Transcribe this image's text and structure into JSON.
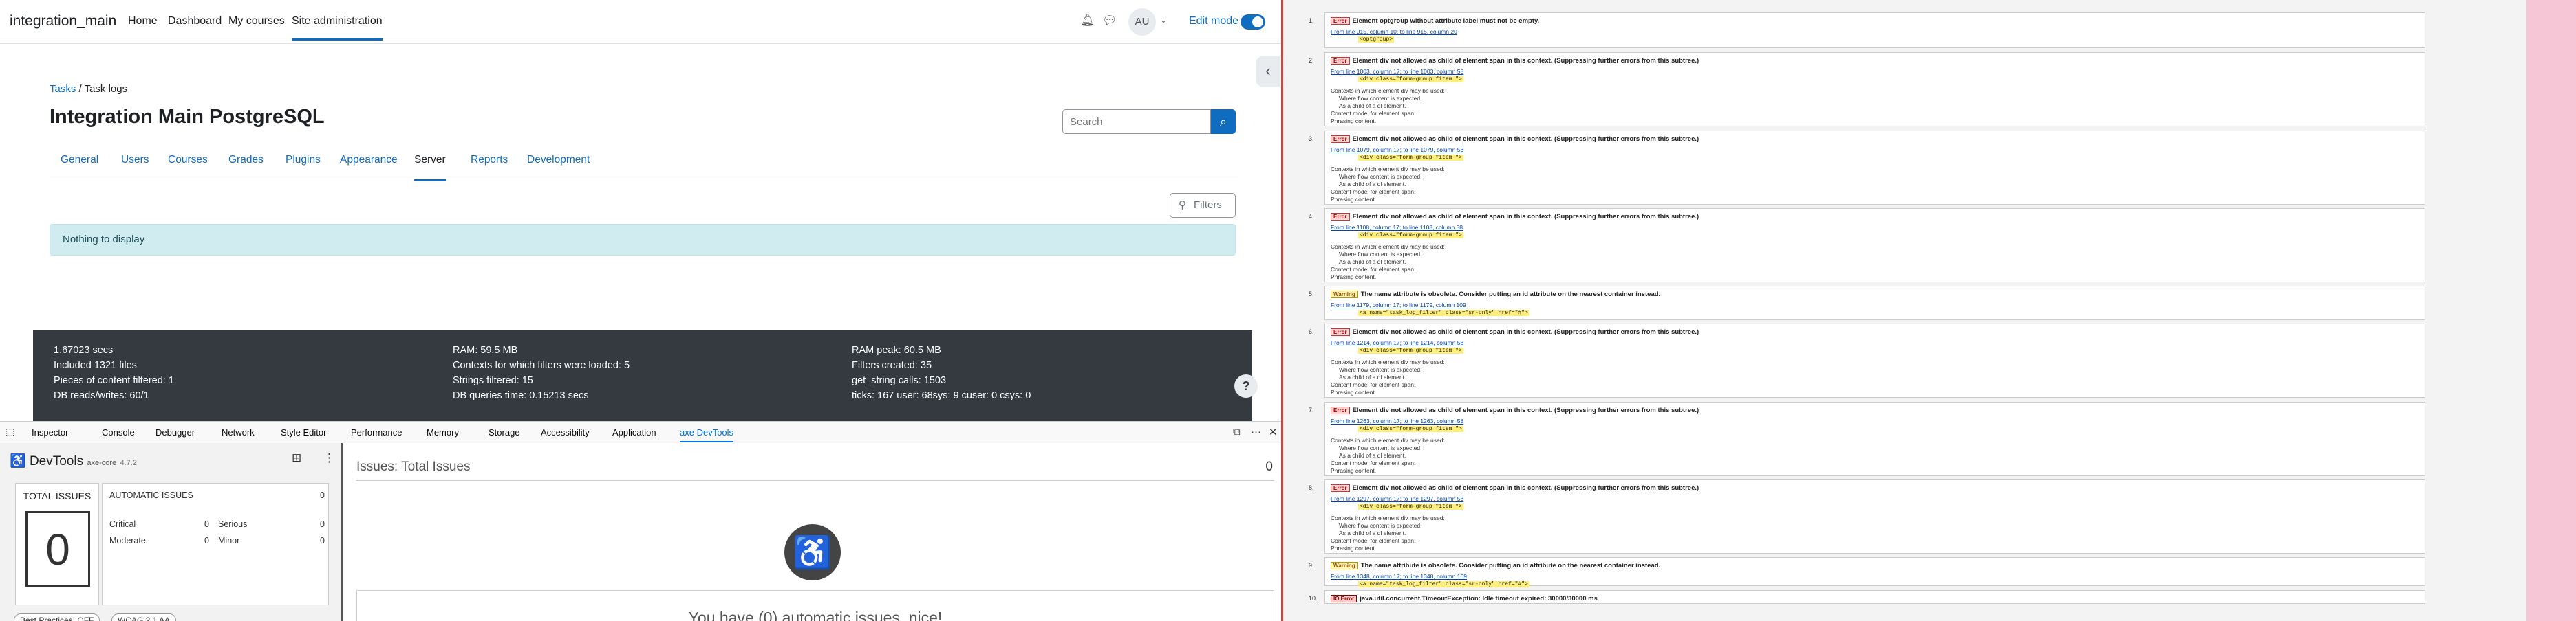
{
  "moodle": {
    "brand": "integration_main",
    "nav": [
      "Home",
      "Dashboard",
      "My courses",
      "Site administration"
    ],
    "nav_active": "Site administration",
    "avatar_initials": "AU",
    "edit_mode_label": "Edit mode",
    "breadcrumb": [
      "Tasks",
      "Task logs"
    ],
    "page_title": "Integration Main PostgreSQL",
    "search_placeholder": "Search",
    "tabs": [
      "General",
      "Users",
      "Courses",
      "Grades",
      "Plugins",
      "Appearance",
      "Server",
      "Reports",
      "Development"
    ],
    "active_tab": "Server",
    "filters_label": "Filters",
    "alert": "Nothing to display",
    "footer": {
      "col1": [
        "1.67023 secs",
        "",
        "Included 1321 files",
        "Pieces of content filtered: 1",
        "DB reads/writes: 60/1"
      ],
      "col2": [
        "RAM: 59.5 MB",
        "",
        "Contexts for which filters were loaded: 5",
        "Strings filtered: 15",
        "DB queries time: 0.15213 secs"
      ],
      "col3": [
        "RAM peak: 60.5 MB",
        "",
        "Filters created: 35",
        "get_string calls: 1503",
        "ticks: 167 user: 68sys: 9 cuser: 0 csys: 0"
      ]
    },
    "help": "?"
  },
  "devtools": {
    "tabs": [
      "Inspector",
      "Console",
      "Debugger",
      "Network",
      "Style Editor",
      "Performance",
      "Memory",
      "Storage",
      "Accessibility",
      "Application",
      "axe DevTools"
    ],
    "active_tab": "axe DevTools",
    "axe": {
      "title": "DevTools",
      "subtitle": "axe-core",
      "version": "4.7.2",
      "total_label": "TOTAL ISSUES",
      "total": "0",
      "auto_label": "AUTOMATIC ISSUES",
      "auto_count": "0",
      "critical_label": "Critical",
      "critical": "0",
      "serious_label": "Serious",
      "serious": "0",
      "moderate_label": "Moderate",
      "moderate": "0",
      "minor_label": "Minor",
      "minor": "0",
      "best_practices": "Best Practices: OFF",
      "wcag": "WCAG 2.1 AA",
      "issues_header": "Issues: Total Issues",
      "issues_count": "0",
      "nice_message": "You have (0) automatic issues, nice!"
    }
  },
  "validator": {
    "entries": [
      {
        "n": "1.",
        "type": "Error",
        "msg": "Element optgroup without attribute label must not be empty.",
        "loc": "From line 915, column 10; to line 915, column 20",
        "code": "<optgroup>",
        "ctx": []
      },
      {
        "n": "2.",
        "type": "Error",
        "msg": "Element div not allowed as child of element span in this context. (Suppressing further errors from this subtree.)",
        "loc": "From line 1003, column 17; to line 1003, column 58",
        "code": "<div class=\"form-group  fitem  \">",
        "ctx": [
          "Contexts in which element div may be used:",
          "Where flow content is expected.",
          "As a child of a dl element.",
          "Content model for element span:",
          "Phrasing content."
        ]
      },
      {
        "n": "3.",
        "type": "Error",
        "msg": "Element div not allowed as child of element span in this context. (Suppressing further errors from this subtree.)",
        "loc": "From line 1079, column 17; to line 1079, column 58",
        "code": "<div class=\"form-group  fitem  \">",
        "ctx": [
          "Contexts in which element div may be used:",
          "Where flow content is expected.",
          "As a child of a dl element.",
          "Content model for element span:",
          "Phrasing content."
        ]
      },
      {
        "n": "4.",
        "type": "Error",
        "msg": "Element div not allowed as child of element span in this context. (Suppressing further errors from this subtree.)",
        "loc": "From line 1108, column 17; to line 1108, column 58",
        "code": "<div class=\"form-group  fitem  \">",
        "ctx": [
          "Contexts in which element div may be used:",
          "Where flow content is expected.",
          "As a child of a dl element.",
          "Content model for element span:",
          "Phrasing content."
        ]
      },
      {
        "n": "5.",
        "type": "Warning",
        "msg": "The name attribute is obsolete. Consider putting an id attribute on the nearest container instead.",
        "loc": "From line 1179, column 17; to line 1179, column 109",
        "code": "<a name=\"task_log_filter\" class=\"sr-only\" href=\"#\">",
        "ctx": []
      },
      {
        "n": "6.",
        "type": "Error",
        "msg": "Element div not allowed as child of element span in this context. (Suppressing further errors from this subtree.)",
        "loc": "From line 1214, column 17; to line 1214, column 58",
        "code": "<div class=\"form-group  fitem  \">",
        "ctx": [
          "Contexts in which element div may be used:",
          "Where flow content is expected.",
          "As a child of a dl element.",
          "Content model for element span:",
          "Phrasing content."
        ]
      },
      {
        "n": "7.",
        "type": "Error",
        "msg": "Element div not allowed as child of element span in this context. (Suppressing further errors from this subtree.)",
        "loc": "From line 1263, column 17; to line 1263, column 58",
        "code": "<div class=\"form-group  fitem  \">",
        "ctx": [
          "Contexts in which element div may be used:",
          "Where flow content is expected.",
          "As a child of a dl element.",
          "Content model for element span:",
          "Phrasing content."
        ]
      },
      {
        "n": "8.",
        "type": "Error",
        "msg": "Element div not allowed as child of element span in this context. (Suppressing further errors from this subtree.)",
        "loc": "From line 1297, column 17; to line 1297, column 58",
        "code": "<div class=\"form-group  fitem  \">",
        "ctx": [
          "Contexts in which element div may be used:",
          "Where flow content is expected.",
          "As a child of a dl element.",
          "Content model for element span:",
          "Phrasing content."
        ]
      },
      {
        "n": "9.",
        "type": "Warning",
        "msg": "The name attribute is obsolete. Consider putting an id attribute on the nearest container instead.",
        "loc": "From line 1348, column 17; to line 1348, column 109",
        "code": "<a name=\"task_log_filter\" class=\"sr-only\" href=\"#\">",
        "ctx": []
      },
      {
        "n": "10.",
        "type": "IO Error",
        "msg": "java.util.concurrent.TimeoutException: Idle timeout expired: 30000/30000 ms",
        "loc": "",
        "code": "",
        "ctx": []
      }
    ]
  }
}
